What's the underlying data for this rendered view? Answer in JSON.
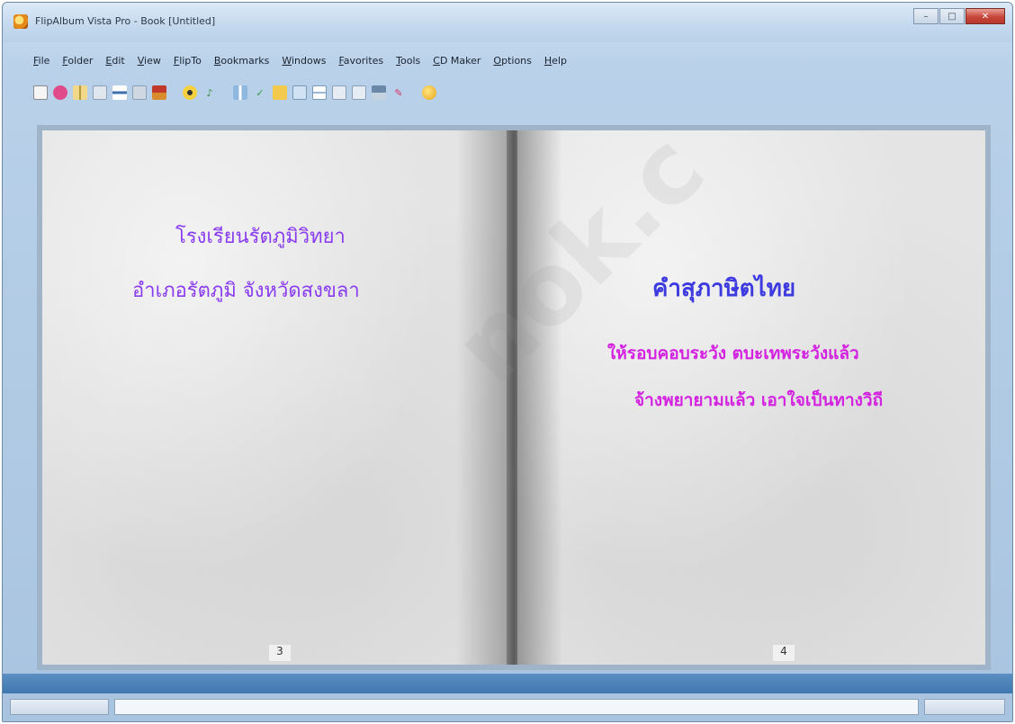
{
  "window": {
    "title": "FlipAlbum Vista Pro - Book [Untitled]",
    "controls": {
      "minimize": "–",
      "maximize": "□",
      "close": "✕"
    }
  },
  "menu": [
    "File",
    "Folder",
    "Edit",
    "View",
    "FlipTo",
    "Bookmarks",
    "Windows",
    "Favorites",
    "Tools",
    "CD Maker",
    "Options",
    "Help"
  ],
  "toolbar_icons": [
    "new-icon",
    "open-icon",
    "album-icon",
    "page-icon",
    "layout-icon",
    "edit-icon",
    "save-icon",
    "burn-icon",
    "music-icon",
    "view-icon",
    "flip-icon",
    "bookmark-icon",
    "thumbnail-icon",
    "zoom-icon",
    "index-icon",
    "slideshow-icon",
    "print-icon",
    "share-icon",
    "help-icon"
  ],
  "book": {
    "left_page": {
      "line1": "โรงเรียนรัตภูมิวิทยา",
      "line2": "อำเภอรัตภูมิ  จังหวัดสงขลา",
      "page_number": "3"
    },
    "right_page": {
      "title": "คำสุภาษิตไทย",
      "line1": "ให้รอบคอบระวัง ตบะเทพระวังแล้ว",
      "line2": "จ้างพยายามแล้ว เอาใจเป็นทางวิถี",
      "page_number": "4"
    }
  },
  "watermark": "nok.c",
  "colors": {
    "left_text": "#8a3cf0",
    "right_title": "#3d3be0",
    "right_text": "#d322e0",
    "band": "#3f77b0"
  }
}
